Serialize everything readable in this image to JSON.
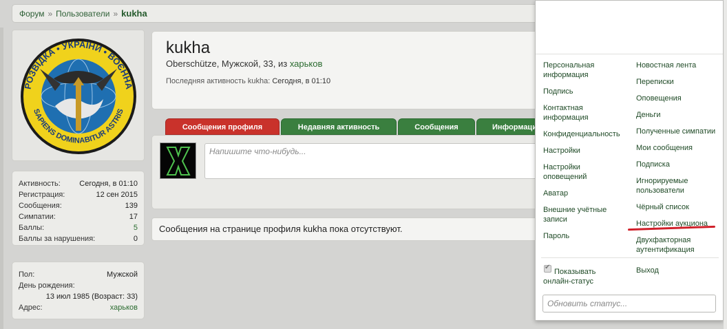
{
  "breadcrumb": {
    "items": [
      "Форум",
      "Пользователи"
    ],
    "current": "kukha",
    "separator": "»"
  },
  "avatar": {
    "emblem_top": "РОЗВІДКА",
    "emblem_left": "ВОЄННА",
    "emblem_right": "УКРАЇНИ",
    "emblem_bottom": "SAPIENS DOMINABITUR ASTRIS"
  },
  "stats": {
    "rows": [
      {
        "k": "Активность:",
        "v": "Сегодня, в 01:10"
      },
      {
        "k": "Регистрация:",
        "v": "12 сен 2015"
      },
      {
        "k": "Сообщения:",
        "v": "139"
      },
      {
        "k": "Симпатии:",
        "v": "17"
      },
      {
        "k": "Баллы:",
        "v": "5"
      },
      {
        "k": "Баллы за нарушения:",
        "v": "0"
      }
    ]
  },
  "about": {
    "gender_label": "Пол:",
    "gender": "Мужской",
    "birthday_label": "День рождения:",
    "birthday": "13 июл 1985 (Возраст: 33)",
    "address_label": "Адрес:",
    "address": "харьков"
  },
  "header": {
    "username": "kukha",
    "info_prefix": "Oberschütze, Мужской, 33, из ",
    "info_city": "харьков",
    "last_activity_label": "Последняя активность kukha:",
    "last_activity_value": "Сегодня, в 01:10"
  },
  "tabs": [
    "Сообщения профиля",
    "Недавняя активность",
    "Сообщения",
    "Информация"
  ],
  "post": {
    "placeholder": "Напишите что-нибудь..."
  },
  "no_messages": "Сообщения на странице профиля kukha пока отсутствуют.",
  "menu": {
    "left": [
      "Персональная информация",
      "Подпись",
      "Контактная информация",
      "Конфиденциальность",
      "Настройки",
      "Настройки оповещений",
      "Аватар",
      "Внешние учётные записи",
      "Пароль"
    ],
    "right": [
      "Новостная лента",
      "Переписки",
      "Оповещения",
      "Деньги",
      "Полученные симпатии",
      "Мои сообщения",
      "Подписка",
      "Игнорируемые пользователи",
      "Чёрный список",
      "Настройки аукциона",
      "Двухфакторная аутентификация",
      "Выход"
    ],
    "show_online": "Показывать онлайн-статус",
    "status_placeholder": "Обновить статус..."
  }
}
